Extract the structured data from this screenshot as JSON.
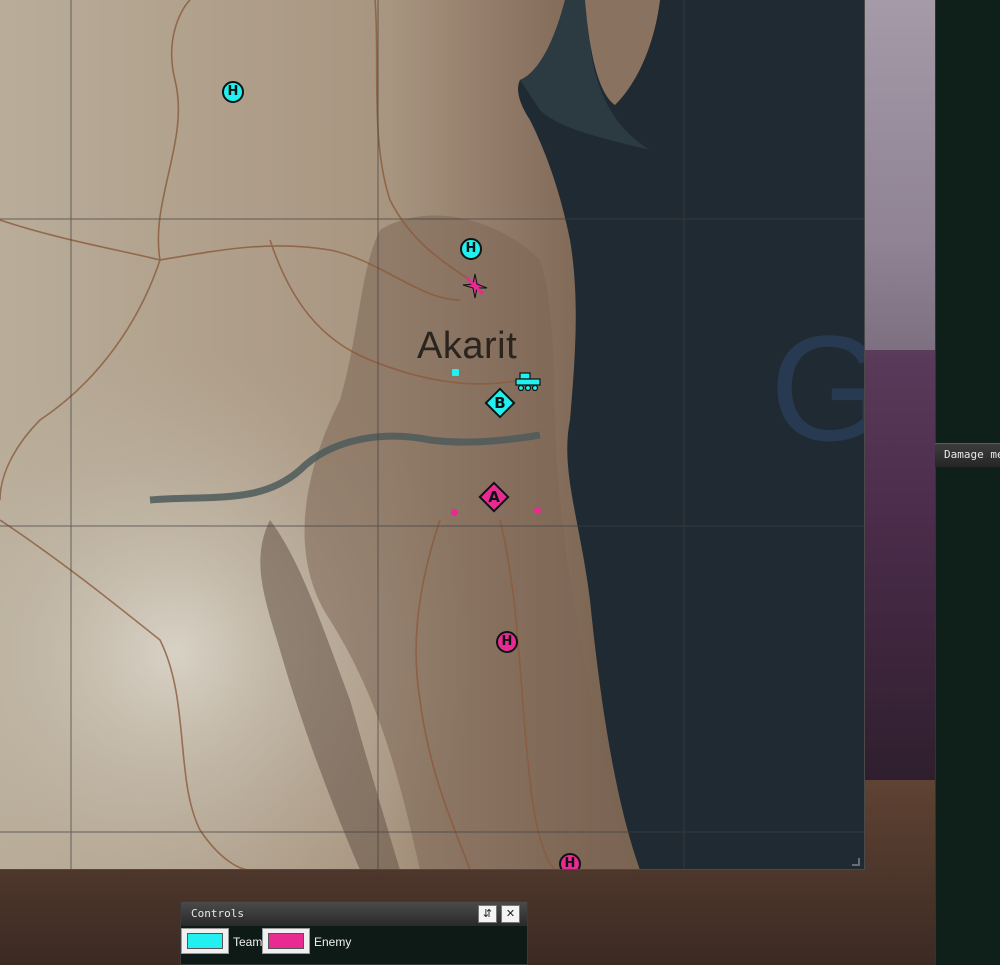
{
  "map": {
    "town_name": "Akarit",
    "markers": {
      "team_heli_label": "H",
      "enemy_heli_label": "H",
      "cap_b": "B",
      "cap_a": "A"
    },
    "icons": {
      "team_vehicle": "tank-icon",
      "enemy_aircraft": "aircraft-icon"
    }
  },
  "damage_panel": {
    "title": "Damage me"
  },
  "controls": {
    "title": "Controls",
    "sort_icon": "⇵",
    "close_icon": "✕",
    "team_label": "Team",
    "enemy_label": "Enemy",
    "team_color": "#22f0f0",
    "enemy_color": "#e82a92"
  }
}
